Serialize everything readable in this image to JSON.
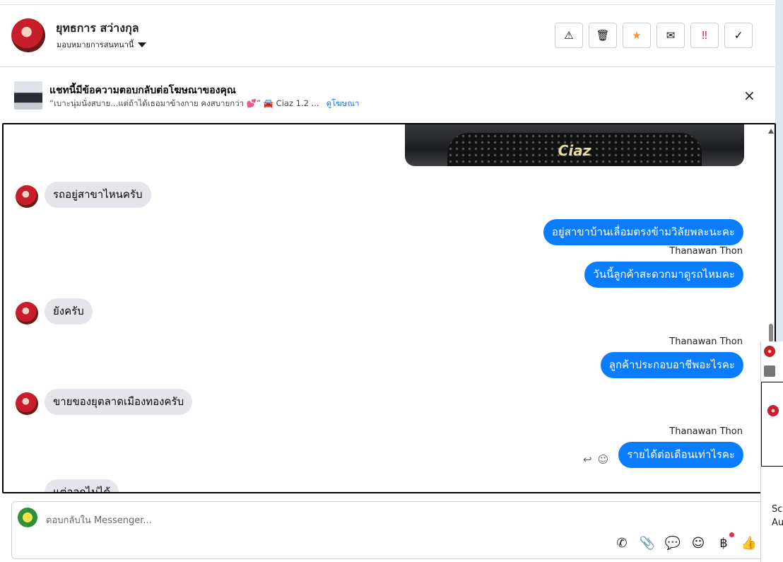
{
  "header": {
    "contact_name": "ยุทธการ สว่างกุล",
    "assign_label": "มอบหมายการสนทนานี้",
    "actions": [
      {
        "name": "report-spam-button",
        "icon": "⚠"
      },
      {
        "name": "delete-button",
        "icon": "🗑"
      },
      {
        "name": "star-button",
        "icon": "★"
      },
      {
        "name": "mark-unread-button",
        "icon": "✉"
      },
      {
        "name": "follow-up-button",
        "icon": "‼"
      },
      {
        "name": "mark-done-button",
        "icon": "✓"
      }
    ]
  },
  "ad": {
    "title": "แชทนี้มีข้อความตอบกลับต่อโฆษณาของคุณ",
    "snippet": "“เบาะนุ่มนั่งสบาย...แต่ถ้าได้เธอมาข้างกาย คงสบายกว่า 💕” 🚘 Ciaz 1.2 ...",
    "link": "ดูโฆษณา",
    "close_icon": "×"
  },
  "car_image": {
    "badge": "Ciaz"
  },
  "messages": [
    {
      "from": "customer",
      "text": "รถอยู่สาขาไหนครับ"
    },
    {
      "from": "page",
      "text": "อยู่สาขาบ้านเลื่อมตรงข้ามวิลัยพละนะคะ"
    },
    {
      "from": "page",
      "sender": "Thanawan Thon",
      "text": "วันนี้ลูกค้าสะดวกมาดูรถไหมคะ"
    },
    {
      "from": "customer",
      "text": "ยังครับ"
    },
    {
      "from": "page",
      "sender": "Thanawan Thon",
      "text": "ลูกค้าประกอบอาชีพอะไรคะ"
    },
    {
      "from": "customer",
      "text": "ขายของยุตลาดเมืองทองครับ"
    },
    {
      "from": "page",
      "sender": "Thanawan Thon",
      "text": "รายได้ต่อเดือนเท่าไรคะ"
    },
    {
      "from": "customer",
      "text": "แต่ออกไม่ได้"
    }
  ],
  "message_tools": {
    "reply_icon": "↩",
    "react_icon": "☺"
  },
  "composer": {
    "placeholder": "ตอบกลับใน Messenger...",
    "tools": [
      {
        "name": "call-add-icon",
        "glyph": "✆"
      },
      {
        "name": "attach-icon",
        "glyph": "📎"
      },
      {
        "name": "saved-reply-icon",
        "glyph": "💬"
      },
      {
        "name": "emoji-icon",
        "glyph": "☺"
      },
      {
        "name": "payment-icon",
        "glyph": "฿"
      },
      {
        "name": "thumbs-up-icon",
        "glyph": "👍"
      }
    ]
  },
  "side_panel": {
    "text_1": "Scr",
    "text_2": "Au"
  }
}
